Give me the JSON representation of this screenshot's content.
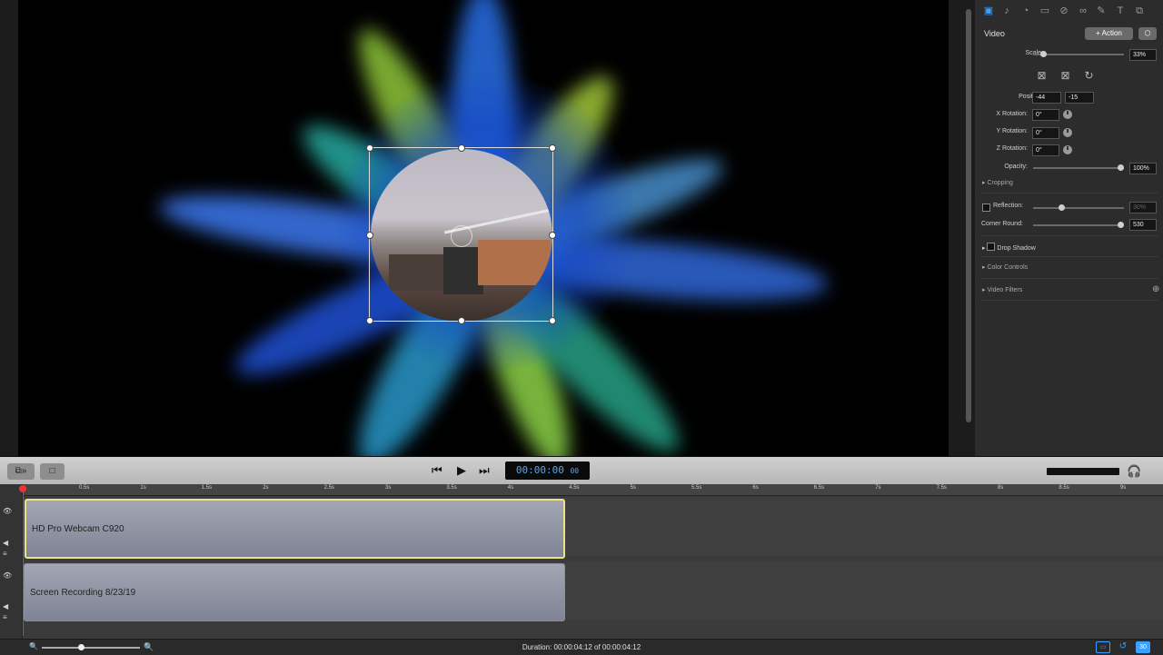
{
  "inspector": {
    "tabs": [
      "video-icon",
      "audio-icon",
      "callout-icon",
      "screen-icon",
      "action-icon",
      "link-icon",
      "pen-icon",
      "text-icon",
      "layers-icon"
    ],
    "title": "Video",
    "action_button": "+ Action",
    "scale_label": "Scale:",
    "scale_value": "33%",
    "position_label": "Position:",
    "position_x": "-44",
    "position_y": "-15",
    "x_rotation_label": "X Rotation:",
    "x_rotation": "0°",
    "y_rotation_label": "Y Rotation:",
    "y_rotation": "0°",
    "z_rotation_label": "Z Rotation:",
    "z_rotation": "0°",
    "opacity_label": "Opacity:",
    "opacity_value": "100%",
    "cropping": "Cropping",
    "reflection_label": "Reflection:",
    "reflection_value": "30%",
    "corner_round_label": "Corner Round:",
    "corner_round_value": "530",
    "drop_shadow": "Drop Shadow",
    "color_controls": "Color Controls",
    "video_filters": "Video Filters"
  },
  "transport": {
    "timecode": "00:00:00",
    "timecode_frames": "00"
  },
  "timeline": {
    "ticks": [
      "0.5s",
      "1s",
      "1.5s",
      "2s",
      "2.5s",
      "3s",
      "3.5s",
      "4s",
      "4.5s",
      "5s",
      "5.5s",
      "6s",
      "6.5s",
      "7s",
      "7.5s",
      "8s",
      "8.5s",
      "9s"
    ],
    "clips": [
      "HD Pro Webcam C920",
      "Screen Recording 8/23/19"
    ],
    "duration": "Duration: 00:00:04:12 of 00:00:04:12"
  },
  "footer": {
    "icons": [
      "cc-icon",
      "loop-icon",
      "3d-icon"
    ],
    "icon_labels": [
      "▭",
      "↺",
      "30"
    ]
  },
  "colors": {
    "accent": "#3ba0ff",
    "selected_clip_border": "#ebe38b",
    "playhead": "#ee3333"
  }
}
